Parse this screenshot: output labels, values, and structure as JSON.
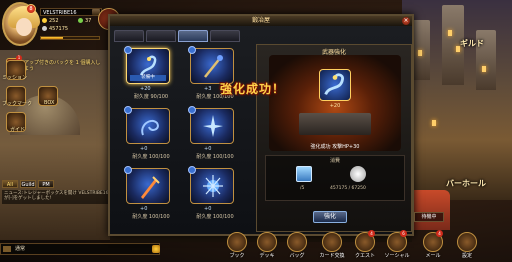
{
  "player": {
    "name": "VELSTRIBE16",
    "level": "8",
    "gold": "252",
    "gems": "37",
    "silver": "457175",
    "exp_fraction": 0.38
  },
  "quests": [
    {
      "text": "アップ付きのバックを 1 個購入しよう",
      "badge": "1"
    },
    {
      "text": "",
      "badge": ""
    }
  ],
  "side_buttons": [
    {
      "label": "ミッション"
    },
    {
      "label": "ブックマーク"
    },
    {
      "label": "BOX"
    },
    {
      "label": "ガイド"
    }
  ],
  "chat": {
    "tabs": [
      "All",
      "Guild",
      "PM"
    ],
    "active_tab": "All",
    "message": "ニュース:トレジャーボックスを開け VELSTRIBE16が[-]をゲットしました!",
    "input_channel": "通常"
  },
  "locations": {
    "guild": "ギルド",
    "bar": "バーホール"
  },
  "dialog": {
    "title": "鍛冶屋",
    "close": "×",
    "tabs": 4,
    "active_tab": 2
  },
  "items": [
    {
      "plus": "+20",
      "durability": "耐久度 90/100",
      "equipped": "装備中",
      "selected": true
    },
    {
      "plus": "+3",
      "durability": "耐久度 100/100",
      "equipped": "",
      "selected": false
    },
    {
      "plus": "+0",
      "durability": "耐久度 100/100",
      "equipped": "",
      "selected": false
    },
    {
      "plus": "+0",
      "durability": "耐久度 100/100",
      "equipped": "",
      "selected": false
    },
    {
      "plus": "+0",
      "durability": "耐久度 100/100",
      "equipped": "",
      "selected": false
    },
    {
      "plus": "+0",
      "durability": "耐久度 100/100",
      "equipped": "",
      "selected": false
    }
  ],
  "enhance": {
    "title": "武器強化",
    "item_plus": "+20",
    "info": "強化成功 攻撃HP+30",
    "consume_title": "消費",
    "material_count": "/5",
    "silver_count": "457175 / 67250",
    "button": "強化"
  },
  "success_text": "強化成功！",
  "bottom_bar": [
    {
      "label": "ブック",
      "badge": ""
    },
    {
      "label": "デッキ",
      "badge": ""
    },
    {
      "label": "バッグ",
      "badge": ""
    },
    {
      "label": "カード交換",
      "badge": ""
    },
    {
      "label": "クエスト",
      "badge": "4"
    },
    {
      "label": "ソーシャル",
      "badge": "6"
    },
    {
      "label": "メール",
      "badge": "4"
    },
    {
      "label": "設定",
      "badge": ""
    }
  ],
  "standby_label": "待機中",
  "colors": {
    "accent_gold": "#ffd34a",
    "panel_border": "#5a4a30",
    "blue_frame": "#3a6ad0"
  }
}
